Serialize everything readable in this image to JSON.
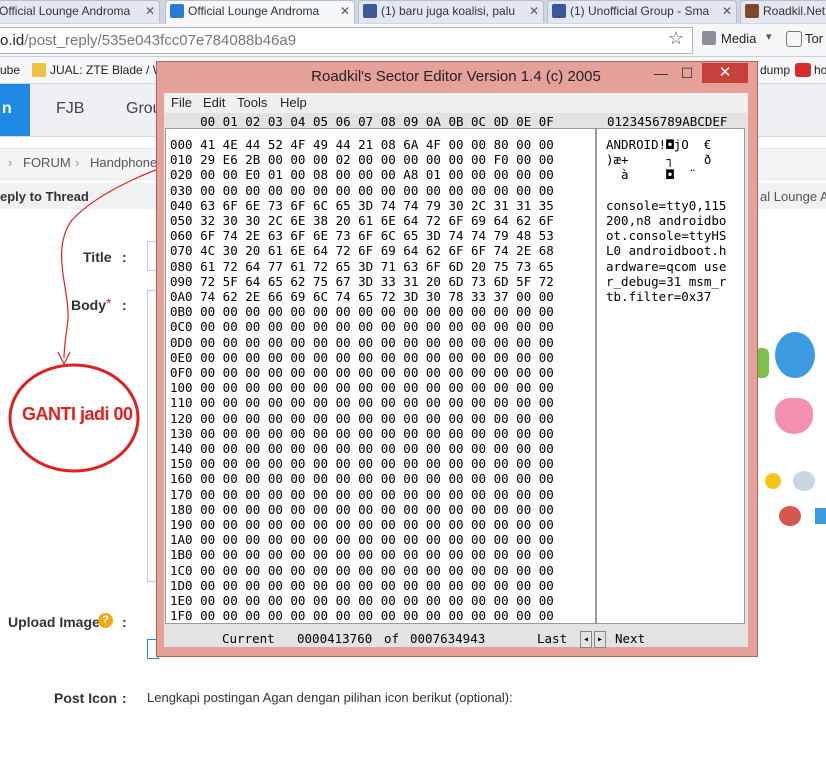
{
  "browser": {
    "tabs": [
      {
        "label": "Official Lounge Androma",
        "active": false,
        "favicon": "kaskus-icon"
      },
      {
        "label": "Official Lounge Androma",
        "active": true,
        "favicon": "kaskus-icon"
      },
      {
        "label": "(1) baru juga koalisi, palu",
        "active": false,
        "favicon": "facebook-icon"
      },
      {
        "label": "(1) Unofficial Group - Sma",
        "active": false,
        "favicon": "facebook-icon"
      },
      {
        "label": "Roadkil.Net",
        "active": false,
        "favicon": "roadkil-icon"
      }
    ],
    "address": {
      "domain": "o.id",
      "path": "/post_reply/535e043fcc07e784088b46a9"
    },
    "media_label": "Media",
    "tor_label": "Tor",
    "bookmarks": [
      "ube",
      "JUAL: ZTE Blade / W",
      "dump",
      "ho"
    ]
  },
  "forum": {
    "nav": [
      "n",
      "FJB",
      "Grou"
    ],
    "breadcrumbs": [
      "FORUM",
      "Handphone"
    ],
    "reply_title": "eply to Thread",
    "thread_tail": "al Lounge An",
    "labels": {
      "title": "Title",
      "body": "Body",
      "upload": "Upload Image",
      "post_icon": "Post Icon"
    },
    "required_mark": "*",
    "colon": ":",
    "post_icon_hint": "Lengkapi postingan Agan dengan pilihan icon berikut (optional):",
    "annotation": "GANTI jadi 00"
  },
  "editor": {
    "title": "Roadkil's Sector Editor Version 1.4 (c) 2005",
    "menu": [
      "File",
      "Edit",
      "Tools",
      "Help"
    ],
    "hex_header": "    00 01 02 03 04 05 06 07 08 09 0A 0B 0C 0D 0E 0F",
    "ascii_header": "0123456789ABCDEF",
    "rows": [
      "000 41 4E 44 52 4F 49 44 21 08 6A 4F 00 00 80 00 00",
      "010 29 E6 2B 00 00 00 02 00 00 00 00 00 00 F0 00 00",
      "020 00 00 E0 01 00 08 00 00 00 A8 01 00 00 00 00 00",
      "030 00 00 00 00 00 00 00 00 00 00 00 00 00 00 00 00",
      "040 63 6F 6E 73 6F 6C 65 3D 74 74 79 30 2C 31 31 35",
      "050 32 30 30 2C 6E 38 20 61 6E 64 72 6F 69 64 62 6F",
      "060 6F 74 2E 63 6F 6E 73 6F 6C 65 3D 74 74 79 48 53",
      "070 4C 30 20 61 6E 64 72 6F 69 64 62 6F 6F 74 2E 68",
      "080 61 72 64 77 61 72 65 3D 71 63 6F 6D 20 75 73 65",
      "090 72 5F 64 65 62 75 67 3D 33 31 20 6D 73 6D 5F 72",
      "0A0 74 62 2E 66 69 6C 74 65 72 3D 30 78 33 37 00 00",
      "0B0 00 00 00 00 00 00 00 00 00 00 00 00 00 00 00 00",
      "0C0 00 00 00 00 00 00 00 00 00 00 00 00 00 00 00 00",
      "0D0 00 00 00 00 00 00 00 00 00 00 00 00 00 00 00 00",
      "0E0 00 00 00 00 00 00 00 00 00 00 00 00 00 00 00 00",
      "0F0 00 00 00 00 00 00 00 00 00 00 00 00 00 00 00 00",
      "100 00 00 00 00 00 00 00 00 00 00 00 00 00 00 00 00",
      "110 00 00 00 00 00 00 00 00 00 00 00 00 00 00 00 00",
      "120 00 00 00 00 00 00 00 00 00 00 00 00 00 00 00 00",
      "130 00 00 00 00 00 00 00 00 00 00 00 00 00 00 00 00",
      "140 00 00 00 00 00 00 00 00 00 00 00 00 00 00 00 00",
      "150 00 00 00 00 00 00 00 00 00 00 00 00 00 00 00 00",
      "160 00 00 00 00 00 00 00 00 00 00 00 00 00 00 00 00",
      "170 00 00 00 00 00 00 00 00 00 00 00 00 00 00 00 00",
      "180 00 00 00 00 00 00 00 00 00 00 00 00 00 00 00 00",
      "190 00 00 00 00 00 00 00 00 00 00 00 00 00 00 00 00",
      "1A0 00 00 00 00 00 00 00 00 00 00 00 00 00 00 00 00",
      "1B0 00 00 00 00 00 00 00 00 00 00 00 00 00 00 00 00",
      "1C0 00 00 00 00 00 00 00 00 00 00 00 00 00 00 00 00",
      "1D0 00 00 00 00 00 00 00 00 00 00 00 00 00 00 00 00",
      "1E0 00 00 00 00 00 00 00 00 00 00 00 00 00 00 00 00",
      "1F0 00 00 00 00 00 00 00 00 00 00 00 00 00 00 00 00"
    ],
    "ascii_lines": [
      "ANDROID!◘jO  €",
      ")æ+     ┐    ð",
      "  à     ◘  ¨",
      "",
      "console=tty0,115",
      "200,n8 androidbo",
      "ot.console=ttyHS",
      "L0 androidboot.h",
      "ardware=qcom use",
      "r_debug=31 msm_r",
      "tb.filter=0x37"
    ],
    "status": {
      "current_label": "Current",
      "current_value": "0000413760",
      "of_label": "of",
      "total_value": "0007634943",
      "last_label": "Last",
      "next_label": "Next"
    }
  },
  "colors": {
    "titlebar": "#e6a19b",
    "close": "#c7403a",
    "annotation": "#e0201e",
    "accent": "#1e88e5"
  }
}
